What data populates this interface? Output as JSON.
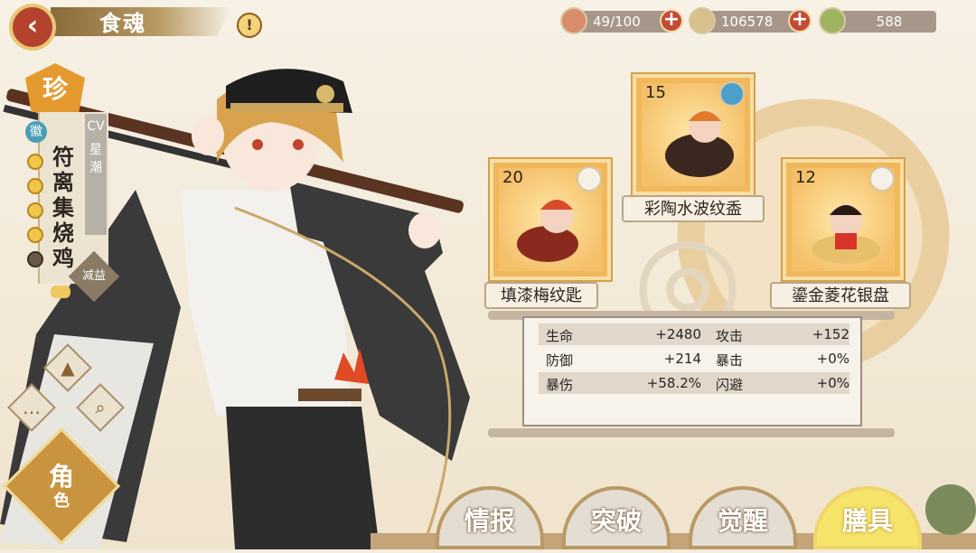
{
  "header": {
    "title": "食魂",
    "back_icon": "back-arrow-icon",
    "alert_icon": "exclamation-icon"
  },
  "resources": [
    {
      "name": "stamina",
      "icon": "rice-bowl-icon",
      "value": "49/100",
      "has_plus": true
    },
    {
      "name": "coins",
      "icon": "coin-icon",
      "value": "106578",
      "has_plus": true
    },
    {
      "name": "jade",
      "icon": "jade-icon",
      "value": "588",
      "has_plus": false
    }
  ],
  "character": {
    "rarity": "珍",
    "badge": "徽",
    "stars": 5,
    "name": "符离集烧鸡",
    "cv_label": "CV",
    "cv_name": "星潮",
    "debuff_label": "减益"
  },
  "side_menu": {
    "role_label_1": "角",
    "role_label_2": "色"
  },
  "equipment": [
    {
      "slot": "left",
      "level": "20",
      "name": "填漆梅纹匙",
      "type_icon": "spoon-icon"
    },
    {
      "slot": "top",
      "level": "15",
      "name": "彩陶水波纹盉",
      "type_icon": "teapot-icon"
    },
    {
      "slot": "right",
      "level": "12",
      "name": "鎏金菱花银盘",
      "type_icon": "plate-icon"
    }
  ],
  "stats": [
    {
      "left_label": "生命",
      "left_value": "+2480",
      "right_label": "攻击",
      "right_value": "+152"
    },
    {
      "left_label": "防御",
      "left_value": "+214",
      "right_label": "暴击",
      "right_value": "+0%"
    },
    {
      "left_label": "暴伤",
      "left_value": "+58.2%",
      "right_label": "闪避",
      "right_value": "+0%"
    }
  ],
  "tabs": [
    {
      "label": "情报",
      "active": false
    },
    {
      "label": "突破",
      "active": false
    },
    {
      "label": "觉醒",
      "active": false
    },
    {
      "label": "膳具",
      "active": true
    }
  ],
  "colors": {
    "accent_red": "#c34a34",
    "gold": "#f0b85a",
    "panel": "#f7f2ea"
  }
}
